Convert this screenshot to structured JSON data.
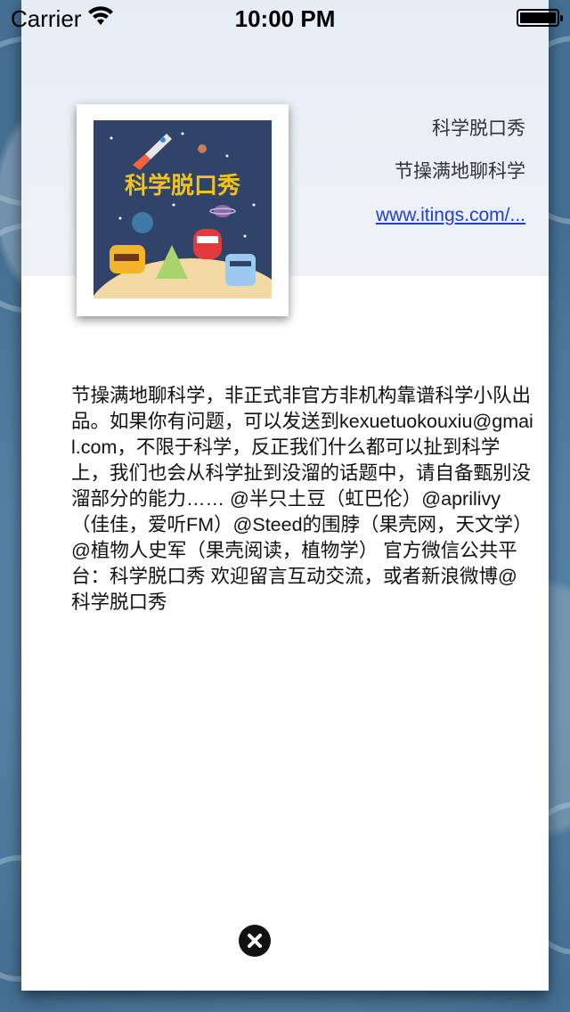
{
  "status_bar": {
    "carrier": "Carrier",
    "time": "10:00 PM"
  },
  "podcast": {
    "cover_title_art": "科学脱口秀",
    "title": "科学脱口秀",
    "subtitle": "节操满地聊科学",
    "link": "www.itings.com/...",
    "description": "节操满地聊科学，非正式非官方非机构靠谱科学小队出品。如果你有问题，可以发送到kexuetuokouxiu@gmail.com，不限于科学，反正我们什么都可以扯到科学上，我们也会从科学扯到没溜的话题中，请自备甄别没溜部分的能力…… @半只土豆（虹巴伦）@aprilivy（佳佳，爱听FM）@Steed的围脖（果壳网，天文学）@植物人史军（果壳阅读，植物学） 官方微信公共平台：科学脱口秀 欢迎留言互动交流，或者新浪微博@科学脱口秀"
  },
  "icons": {
    "wifi": "wifi-icon",
    "battery": "battery-icon",
    "close": "close-icon"
  },
  "colors": {
    "link": "#1f3fd6",
    "cover_background": "#2f4468",
    "cover_title": "#f3c21b"
  }
}
